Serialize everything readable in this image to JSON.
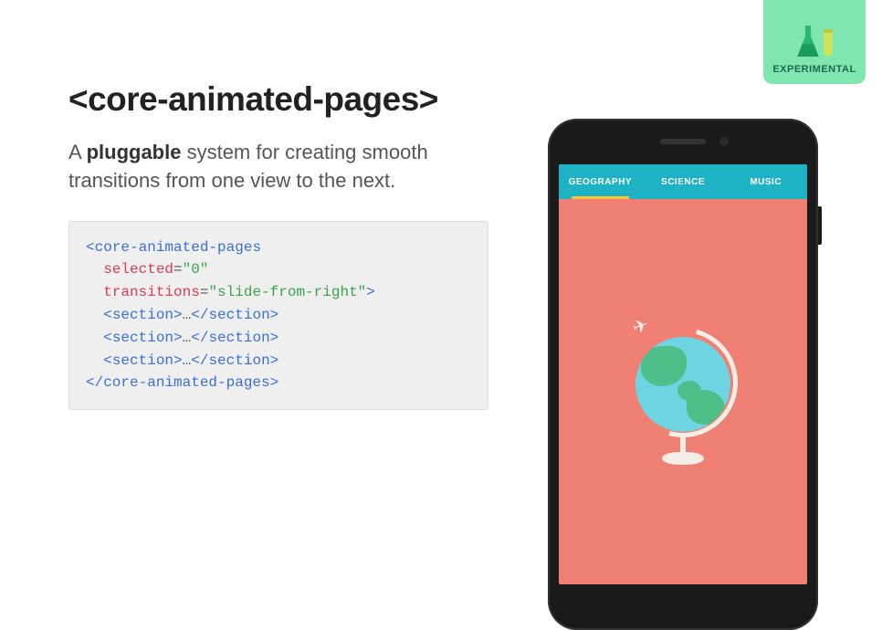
{
  "badge": {
    "label": "EXPERIMENTAL"
  },
  "title": "<core-animated-pages>",
  "description": {
    "pre": "A ",
    "bold": "pluggable",
    "post": " system for creating smooth transitions from one view to the next."
  },
  "code": {
    "open_tag": "core-animated-pages",
    "attr_selected_name": "selected",
    "attr_selected_value": "\"0\"",
    "attr_transitions_name": "transitions",
    "attr_transitions_value": "\"slide-from-right\"",
    "section_tag": "section",
    "ellipsis": "…",
    "close_tag": "core-animated-pages"
  },
  "phone": {
    "tabs": [
      {
        "label": "GEOGRAPHY",
        "active": true
      },
      {
        "label": "SCIENCE",
        "active": false
      },
      {
        "label": "MUSIC",
        "active": false
      }
    ]
  }
}
